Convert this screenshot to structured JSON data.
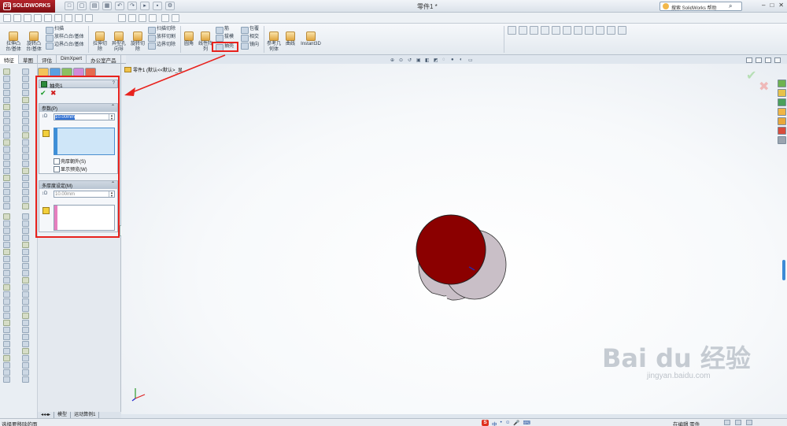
{
  "app": {
    "brand": "SOLIDWORKS",
    "window_title": "零件1 *",
    "search_placeholder": "搜索 SolidWorks 帮助",
    "win_min": "–",
    "win_restore": "□",
    "win_close": "✕"
  },
  "quick_icons": [
    "□",
    "▢",
    "▤",
    "▦",
    "↶",
    "↷",
    "▸",
    "▪",
    "⚙"
  ],
  "command_manager": {
    "big": [
      {
        "label": "拉伸凸\n台/基体"
      },
      {
        "label": "旋转凸\n台/基体"
      },
      {
        "label": "拉伸切\n除"
      },
      {
        "label": "异型孔\n向导"
      },
      {
        "label": "旋转切\n除"
      },
      {
        "label": "圆角"
      },
      {
        "label": "线性阵\n列"
      },
      {
        "label": "参考几\n何体"
      },
      {
        "label": "曲线"
      },
      {
        "label": "Instant3D"
      }
    ],
    "small": [
      "扫描",
      "放样凸台/基体",
      "边界凸台/基体",
      "扫描切除",
      "放样切割",
      "边界切除",
      "筋",
      "拔模",
      "抽壳",
      "包覆",
      "相交",
      "镜向"
    ],
    "highlighted": "抽壳"
  },
  "tabs": [
    {
      "label": "特征",
      "active": true
    },
    {
      "label": "草图",
      "active": false
    },
    {
      "label": "评估",
      "active": false
    },
    {
      "label": "DimXpert",
      "active": false
    },
    {
      "label": "办公室产品",
      "active": false
    }
  ],
  "property_manager": {
    "title": "抽壳1",
    "help": "?",
    "ok": "✔",
    "cancel": "✖",
    "params_header": "参数(P)",
    "thickness": "10.00mm",
    "shell_outward": "壳厚朝外(S)",
    "show_preview": "显示预览(W)",
    "multi_header": "多厚度设定(M)",
    "multi_thickness": "10.00mm",
    "chev": "⌃"
  },
  "graphics": {
    "tree_path": "零件1 (默认<<默认>_显",
    "watermark": "Bai du 经验",
    "watermark_sub": "jingyan.baidu.com"
  },
  "colors": {
    "top_face": "#8b0000",
    "cylinder_side": "#c9bfc7",
    "annotation": "#e8221d"
  },
  "bottom_tabs": [
    "模型",
    "运动算例1"
  ],
  "status": {
    "left": "选择要移除的面",
    "right": "在编辑 零件",
    "ime": [
      "中",
      "•",
      "☺",
      "🎤",
      "⌨"
    ]
  }
}
